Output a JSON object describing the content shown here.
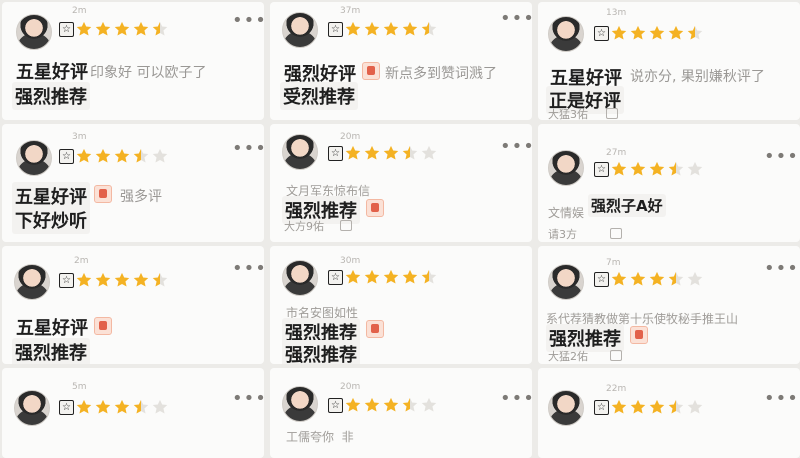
{
  "colors": {
    "star": "#f4b223",
    "star_empty": "#e3e1dd",
    "badge_border": "#222222"
  },
  "reviews": [
    {
      "ratings": 4.5,
      "meta": "2m",
      "lines": [
        "五星好评",
        "印象好",
        "可以欧子了",
        "强烈推荐"
      ]
    },
    {
      "ratings": 4.5,
      "meta": "37m",
      "lines": [
        "强烈好评",
        "新点多到赞词溅了",
        "受烈推荐"
      ]
    },
    {
      "ratings": 4.5,
      "meta": "13m",
      "lines": [
        "五星好评",
        "说亦分,",
        "果别嫌秋评了",
        "正是好评",
        "大猛3佑"
      ]
    },
    {
      "ratings": 3.5,
      "meta": "3m",
      "lines": [
        "五星好评",
        "强多评",
        "下好炒听"
      ]
    },
    {
      "ratings": 3.5,
      "meta": "20m",
      "lines": [
        "文月军东惊布信",
        "强烈推荐",
        "大方9佑"
      ]
    },
    {
      "ratings": 3.5,
      "meta": "27m",
      "lines": [
        "文情娱",
        "强烈子A好",
        "请3方"
      ]
    },
    {
      "ratings": 4.5,
      "meta": "2m",
      "lines": [
        "五星好评",
        "强烈推荐"
      ]
    },
    {
      "ratings": 4.5,
      "meta": "30m",
      "lines": [
        "市名安图如性",
        "强烈推荐",
        "强烈推荐"
      ]
    },
    {
      "ratings": 3.5,
      "meta": "7m",
      "lines": [
        "系代荐猜教做第十乐使牧秘手推王山",
        "强烈推荐",
        "大猛2佑"
      ]
    },
    {
      "ratings": 3.5,
      "meta": "5m",
      "lines": []
    },
    {
      "ratings": 3.5,
      "meta": "20m",
      "lines": [
        "工儒夸你",
        "非"
      ]
    },
    {
      "ratings": 3.5,
      "meta": "22m",
      "lines": []
    }
  ]
}
